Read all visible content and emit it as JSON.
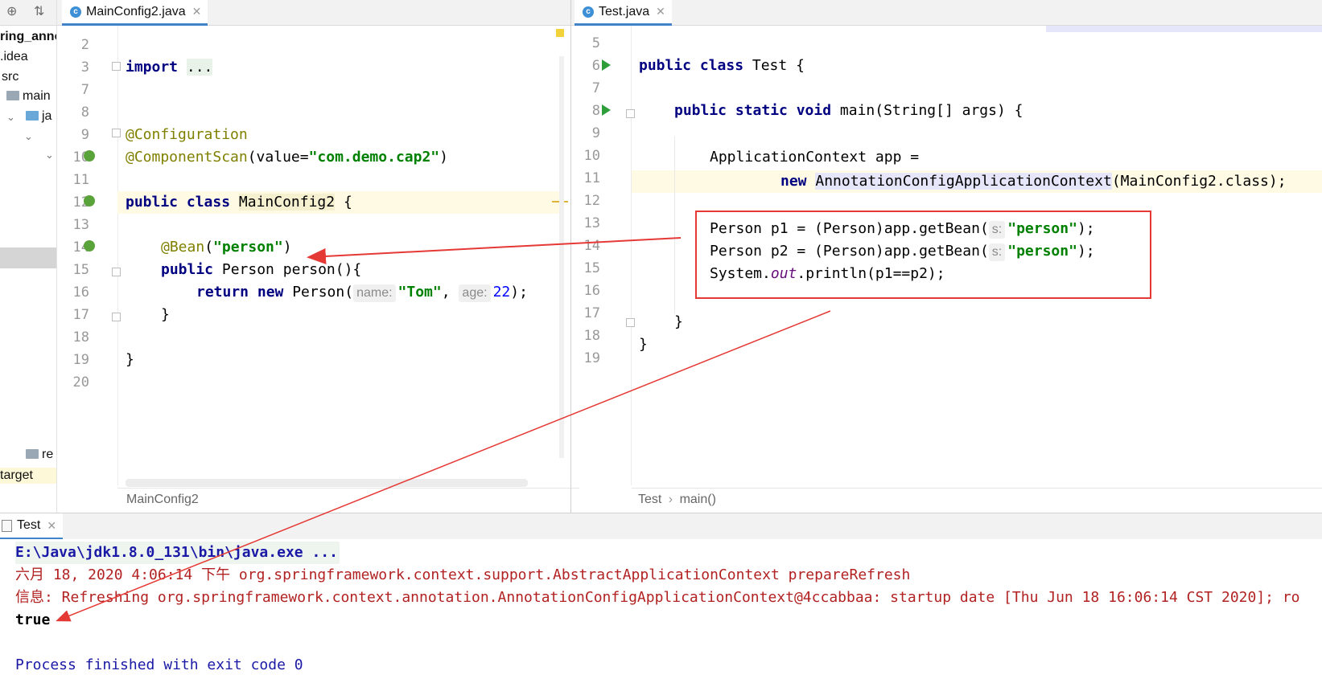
{
  "sidebar": {
    "items": [
      {
        "label": "ring_anno"
      },
      {
        "label": ".idea"
      },
      {
        "label": "src"
      },
      {
        "label": "main"
      },
      {
        "label": "ja"
      },
      {
        "label": "re"
      },
      {
        "label": "target"
      }
    ]
  },
  "left_editor": {
    "tab_label": "MainConfig2.java",
    "tab_close": "✕",
    "line_numbers": [
      "2",
      "3",
      "7",
      "8",
      "9",
      "10",
      "11",
      "12",
      "13",
      "14",
      "15",
      "16",
      "17",
      "18",
      "19",
      "20"
    ],
    "breadcrumb": "MainConfig2",
    "code": {
      "import_kw": "import",
      "import_fold": "...",
      "configuration": "@Configuration",
      "componentscan_ann": "@ComponentScan",
      "componentscan_open": "(value=",
      "componentscan_value": "\"com.demo.cap2\"",
      "componentscan_close": ")",
      "public_class_kw": "public class",
      "class_name": "MainConfig2",
      "class_brace": " {",
      "bean_ann": "@Bean",
      "bean_open": "(",
      "bean_value": "\"person\"",
      "bean_close": ")",
      "method_public": "public",
      "method_sig": " Person person(){",
      "return_new_kw": "return new",
      "return_ctor": " Person(",
      "hint_name": "name:",
      "arg_tom": "\"Tom\"",
      "comma": ",",
      "hint_age": "age:",
      "arg_age": "22",
      "return_end": ");",
      "close_method": "}",
      "close_class": "}"
    }
  },
  "right_editor": {
    "tab_label": "Test.java",
    "tab_close": "✕",
    "line_numbers": [
      "5",
      "6",
      "7",
      "8",
      "9",
      "10",
      "11",
      "12",
      "13",
      "14",
      "15",
      "16",
      "17",
      "18",
      "19"
    ],
    "breadcrumb_class": "Test",
    "breadcrumb_sep": "›",
    "breadcrumb_method": "main()",
    "code": {
      "public_class_kw": "public class",
      "class_decl": " Test {",
      "main_kw": "public static void",
      "main_sig": " main(String[] args) {",
      "app_decl": "ApplicationContext app =",
      "new_kw": "new",
      "ctor_name": "AnnotationConfigApplicationContext",
      "ctor_args": "(MainConfig2.class);",
      "p1_decl": "Person p1 = (Person)app.getBean(",
      "p2_decl": "Person p2 = (Person)app.getBean(",
      "hint_s": "s:",
      "getbean_arg": "\"person\"",
      "getbean_end": ");",
      "print_prefix": "System.",
      "print_out": "out",
      "print_suffix": ".println(p1==p2);",
      "close_method": "}",
      "close_class": "}"
    }
  },
  "console": {
    "tab_label": "Test",
    "tab_close": "✕",
    "lines": {
      "java_exe": "E:\\Java\\jdk1.8.0_131\\bin\\java.exe ...",
      "log1": "六月 18, 2020 4:06:14 下午 org.springframework.context.support.AbstractApplicationContext prepareRefresh",
      "log2": "信息: Refreshing org.springframework.context.annotation.AnnotationConfigApplicationContext@4ccabbaa: startup date [Thu Jun 18 16:06:14 CST 2020]; ro",
      "result": "true",
      "finished": "Process finished with exit code 0"
    }
  },
  "colors": {
    "keyword": "#000080",
    "annotation": "#808000",
    "string": "#008000",
    "number": "#0000ff",
    "console_log": "#b22222",
    "console_process": "#1a1aa6",
    "callout_red": "#e53935"
  },
  "icons": [
    "settings-target-icon",
    "collapse-icon",
    "class-c-icon",
    "run-triangle-icon",
    "spring-bean-icon",
    "fold-marker-icon",
    "folder-icon"
  ]
}
